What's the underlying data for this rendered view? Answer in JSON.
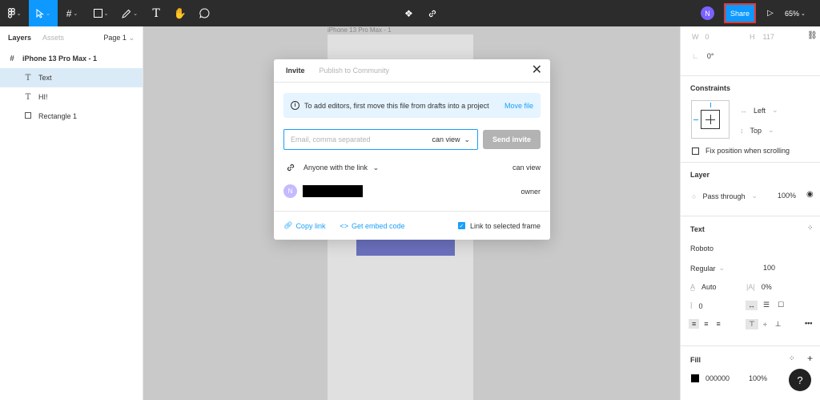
{
  "toolbar": {
    "share_label": "Share",
    "user_initial": "N",
    "zoom": "65%"
  },
  "left_panel": {
    "tab_layers": "Layers",
    "tab_assets": "Assets",
    "page_selector": "Page 1",
    "layers": [
      {
        "name": "iPhone 13 Pro Max - 1",
        "icon": "frame-icon"
      },
      {
        "name": "Text",
        "icon": "text-icon"
      },
      {
        "name": "HI!",
        "icon": "text-icon"
      },
      {
        "name": "Rectangle 1",
        "icon": "rectangle-icon"
      }
    ]
  },
  "canvas": {
    "frame_label": "iPhone 13 Pro Max - 1"
  },
  "modal": {
    "tab_invite": "Invite",
    "tab_publish": "Publish to Community",
    "info_text": "To add editors, first move this file from drafts into a project",
    "info_link": "Move file",
    "email_placeholder": "Email, comma separated",
    "email_permission": "can view",
    "send_button": "Send invite",
    "link_access": "Anyone with the link",
    "link_permission": "can view",
    "user_initial": "N",
    "user_role": "owner",
    "copy_link": "Copy link",
    "embed_code": "Get embed code",
    "link_frame_label": "Link to selected frame"
  },
  "right_panel": {
    "w_label": "W",
    "w_value": "0",
    "h_label": "H",
    "h_value": "117",
    "rotation": "0°",
    "constraints_title": "Constraints",
    "constraint_h": "Left",
    "constraint_v": "Top",
    "fix_position": "Fix position when scrolling",
    "layer_title": "Layer",
    "blend_mode": "Pass through",
    "layer_opacity": "100%",
    "text_title": "Text",
    "font_family": "Roboto",
    "font_weight": "Regular",
    "font_size": "100",
    "line_height": "Auto",
    "letter_spacing": "0%",
    "letter_spacing_icon": "|A|",
    "paragraph_spacing": "0",
    "fill_title": "Fill",
    "fill_hex": "000000",
    "fill_opacity": "100%"
  },
  "colors": {
    "accent": "#0d99ff",
    "share_highlight": "#e53935",
    "toolbar_bg": "#2c2c2c",
    "rectangle_fill": "#7a81d8"
  }
}
